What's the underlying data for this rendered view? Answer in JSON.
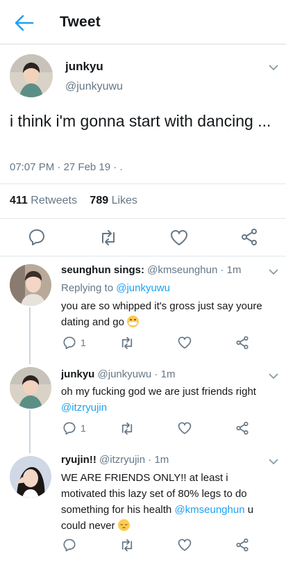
{
  "header": {
    "title": "Tweet"
  },
  "main_tweet": {
    "name": "junkyu",
    "handle": "@junkyuwu",
    "text": "i think i'm gonna start with dancing ...",
    "time": "07:07 PM",
    "date": "27 Feb 19",
    "retweets_count": "411",
    "retweets_label": "Retweets",
    "likes_count": "789",
    "likes_label": "Likes"
  },
  "replies": [
    {
      "name": "seunghun sings:",
      "handle": "@kmseunghun",
      "time": "1m",
      "replying_to_label": "Replying to",
      "replying_to_handle": "@junkyuwu",
      "text": "you are so whipped it's gross just say youre dating and go",
      "emoji": "face-with-medical-mask",
      "reply_count": "1"
    },
    {
      "name": "junkyu",
      "handle": "@junkyuwu",
      "time": "1m",
      "text": "oh my fucking god we are just friends right",
      "mention": "@itzryujin",
      "reply_count": "1"
    },
    {
      "name": "ryujin!!",
      "handle": "@itzryujin",
      "time": "1m",
      "text_part1": "WE ARE FRIENDS ONLY!! at least i motivated this lazy set of 80% legs to do something for his health",
      "mention": "@kmseunghun",
      "text_part2": "u could never",
      "emoji": "pensive-face"
    }
  ],
  "icons": {
    "back": "arrow-left-icon",
    "reply": "speech-bubble-icon",
    "retweet": "retweet-icon",
    "like": "heart-icon",
    "share": "share-icon",
    "more": "chevron-down-icon"
  },
  "colors": {
    "accent": "#1da1f2",
    "muted": "#657786",
    "text": "#14171a",
    "divider": "#e1e8ed"
  }
}
